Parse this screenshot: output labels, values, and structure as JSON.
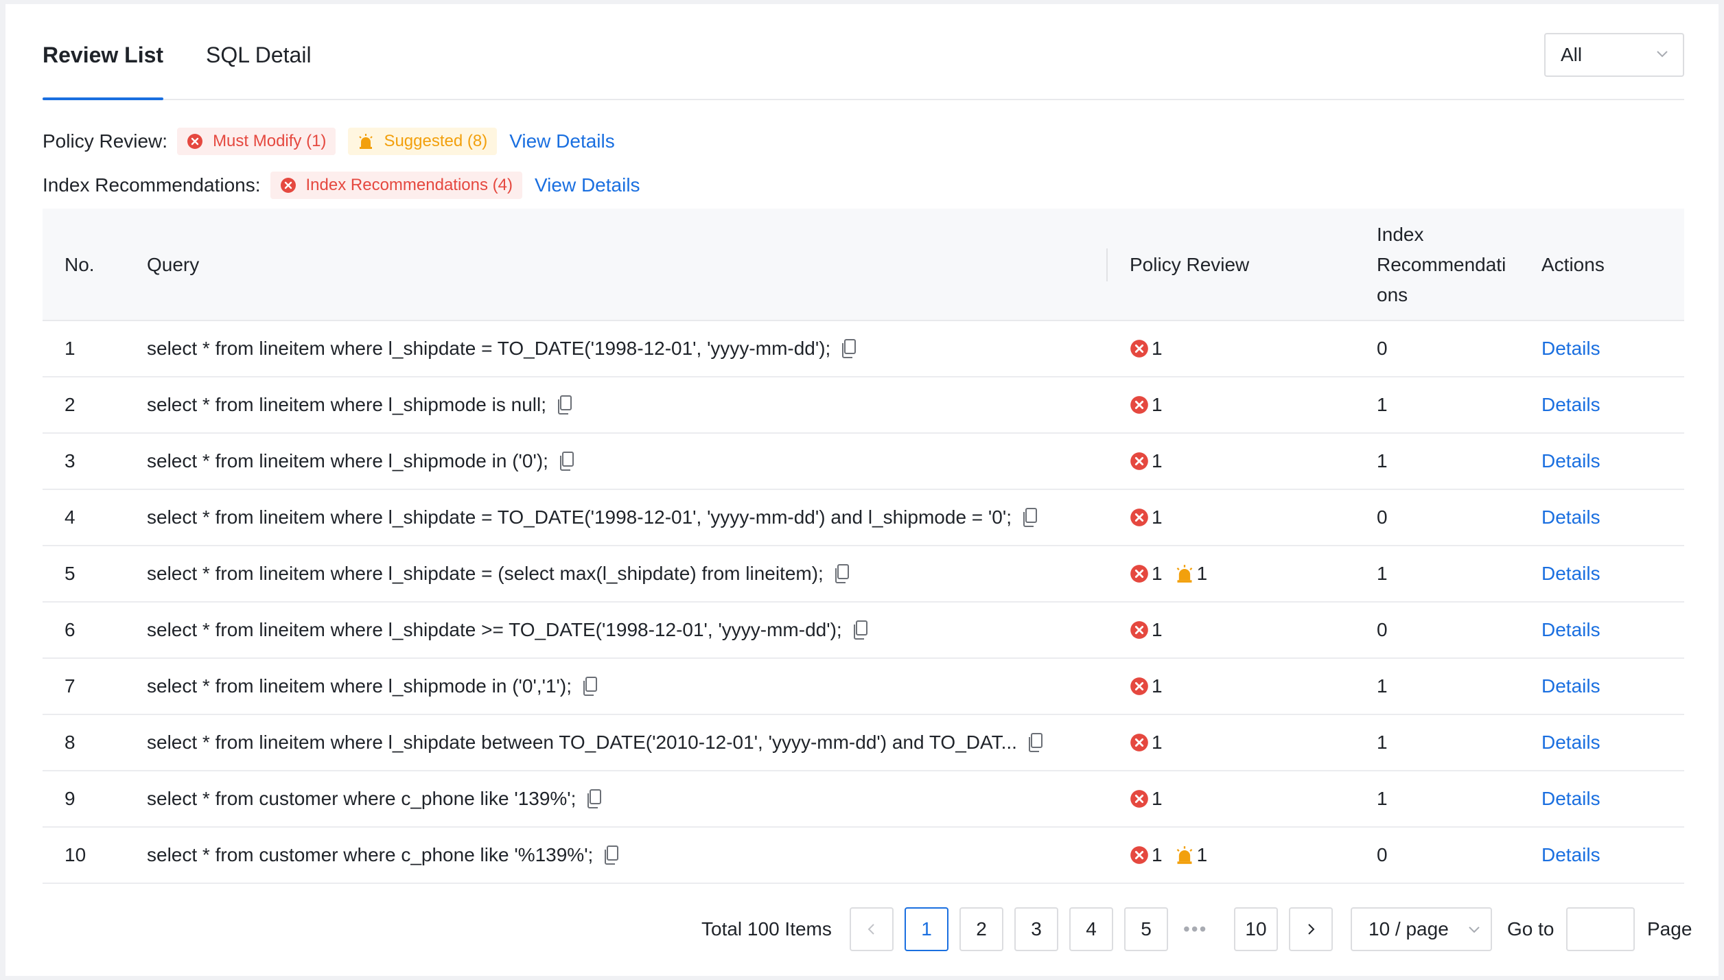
{
  "tabs": [
    {
      "label": "Review List",
      "active": true
    },
    {
      "label": "SQL Detail",
      "active": false
    }
  ],
  "filter": {
    "selected": "All"
  },
  "summary": {
    "policy_label": "Policy Review",
    "policy_colon": ":",
    "must_modify": "Must Modify (1)",
    "suggested": "Suggested (8)",
    "view_details_1": "View Details",
    "index_label": "Index Recommendations",
    "index_colon": ":",
    "index_tag": "Index Recommendations (4)",
    "view_details_2": "View Details"
  },
  "table": {
    "headers": {
      "no": "No.",
      "query": "Query",
      "policy": "Policy Review",
      "index_1": "Index",
      "index_2": "Recommendati",
      "index_3": "ons",
      "actions": "Actions"
    },
    "rows": [
      {
        "no": "1",
        "query": "select * from lineitem where l_shipdate = TO_DATE('1998-12-01', 'yyyy-mm-dd');",
        "errors": "1",
        "warnings": "",
        "index": "0",
        "action": "Details"
      },
      {
        "no": "2",
        "query": "select * from lineitem where l_shipmode is null;",
        "errors": "1",
        "warnings": "",
        "index": "1",
        "action": "Details"
      },
      {
        "no": "3",
        "query": "select * from lineitem where l_shipmode in ('0');",
        "errors": "1",
        "warnings": "",
        "index": "1",
        "action": "Details"
      },
      {
        "no": "4",
        "query": "select * from lineitem where l_shipdate = TO_DATE('1998-12-01', 'yyyy-mm-dd') and l_shipmode = '0';",
        "errors": "1",
        "warnings": "",
        "index": "0",
        "action": "Details"
      },
      {
        "no": "5",
        "query": "select * from lineitem where l_shipdate = (select max(l_shipdate) from lineitem);",
        "errors": "1",
        "warnings": "1",
        "index": "1",
        "action": "Details"
      },
      {
        "no": "6",
        "query": "select * from lineitem where l_shipdate >= TO_DATE('1998-12-01', 'yyyy-mm-dd');",
        "errors": "1",
        "warnings": "",
        "index": "0",
        "action": "Details"
      },
      {
        "no": "7",
        "query": "select * from lineitem where l_shipmode in ('0','1');",
        "errors": "1",
        "warnings": "",
        "index": "1",
        "action": "Details"
      },
      {
        "no": "8",
        "query": "select * from lineitem where l_shipdate between TO_DATE('2010-12-01', 'yyyy-mm-dd') and TO_DAT...",
        "errors": "1",
        "warnings": "",
        "index": "1",
        "action": "Details"
      },
      {
        "no": "9",
        "query": "select * from customer where c_phone like '139%';",
        "errors": "1",
        "warnings": "",
        "index": "1",
        "action": "Details"
      },
      {
        "no": "10",
        "query": "select * from customer where c_phone like '%139%';",
        "errors": "1",
        "warnings": "1",
        "index": "0",
        "action": "Details"
      }
    ]
  },
  "pagination": {
    "total": "Total 100 Items",
    "pages": [
      "1",
      "2",
      "3",
      "4",
      "5"
    ],
    "ellipsis": "•••",
    "last": "10",
    "current": "1",
    "page_size": "10 / page",
    "goto": "Go to",
    "page_word": "Page"
  },
  "colors": {
    "accent": "#1a6fe0",
    "error": "#e5483f",
    "warning": "#f2a00d"
  }
}
